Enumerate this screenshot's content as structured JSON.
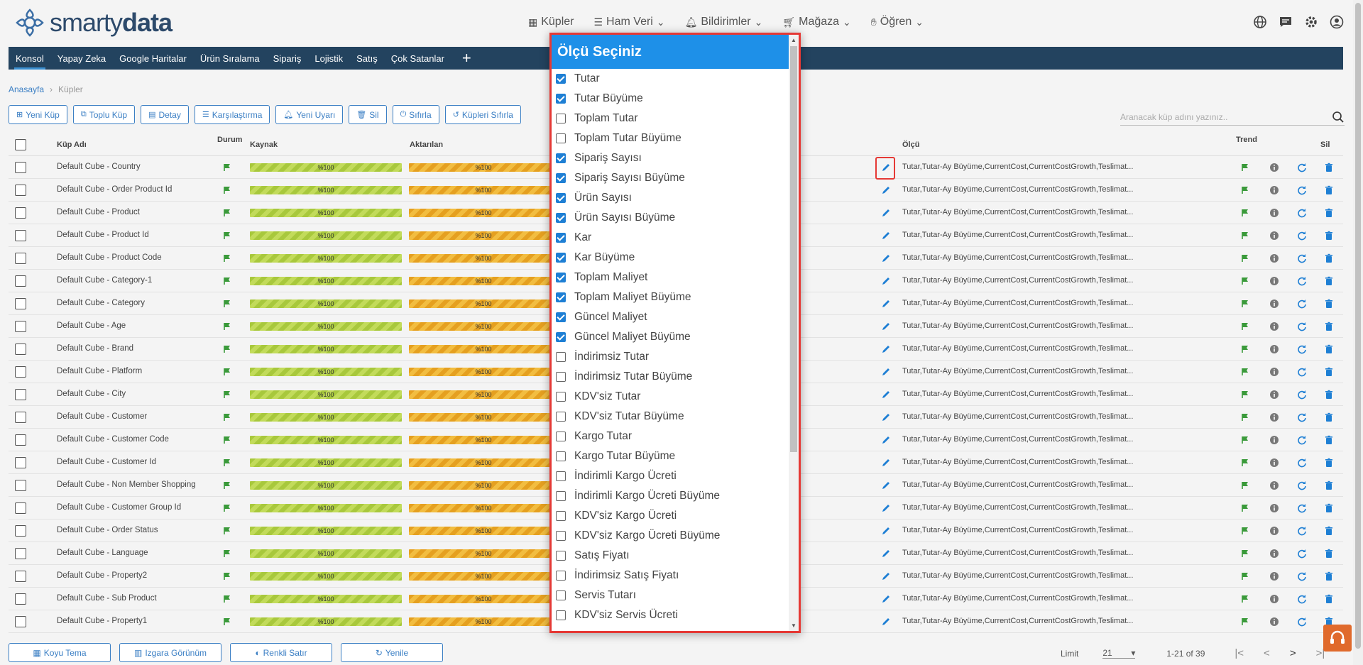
{
  "header": {
    "logo_text_light": "smarty",
    "logo_text_bold": "data",
    "nav": [
      {
        "label": "Küpler",
        "icon": "grid-icon"
      },
      {
        "label": "Ham Veri",
        "icon": "list-icon"
      },
      {
        "label": "Bildirimler",
        "icon": "bell-icon"
      },
      {
        "label": "Mağaza",
        "icon": "cart-icon"
      },
      {
        "label": "Öğren",
        "icon": "hand-icon"
      }
    ]
  },
  "tabs": [
    "Konsol",
    "Yapay Zeka",
    "Google Haritalar",
    "Ürün Sıralama",
    "Sipariş",
    "Lojistik",
    "Satış",
    "Çok Satanlar"
  ],
  "breadcrumb": {
    "home": "Anasayfa",
    "current": "Küpler"
  },
  "toolbar": [
    "Yeni Küp",
    "Toplu Küp",
    "Detay",
    "Karşılaştırma",
    "Yeni Uyarı",
    "Sil",
    "Sıfırla",
    "Küpleri Sıfırla"
  ],
  "search": {
    "placeholder": "Aranacak küp adını yazınız.."
  },
  "table": {
    "headers": {
      "name": "Küp Adı",
      "status": "Durum",
      "source": "Kaynak",
      "transferred": "Aktarılan",
      "measure": "Ölçü",
      "trend": "Trend",
      "delete": "Sil"
    },
    "bar_label": "%100",
    "measure_text": "Tutar,Tutar-Ay Büyüme,CurrentCost,CurrentCostGrowth,Teslimat...",
    "rows": [
      "Default Cube - Country",
      "Default Cube - Order Product Id",
      "Default Cube - Product",
      "Default Cube - Product Id",
      "Default Cube - Product Code",
      "Default Cube - Category-1",
      "Default Cube - Category",
      "Default Cube - Age",
      "Default Cube - Brand",
      "Default Cube - Platform",
      "Default Cube - City",
      "Default Cube - Customer",
      "Default Cube - Customer Code",
      "Default Cube - Customer Id",
      "Default Cube - Non Member Shopping",
      "Default Cube - Customer Group Id",
      "Default Cube - Order Status",
      "Default Cube - Language",
      "Default Cube - Property2",
      "Default Cube - Sub Product",
      "Default Cube - Property1"
    ]
  },
  "footer": {
    "buttons": [
      "Koyu Tema",
      "Izgara Görünüm",
      "Renkli Satır",
      "Yenile"
    ],
    "limit_label": "Limit",
    "limit_value": "21",
    "range": "1-21 of 39"
  },
  "modal": {
    "title": "Ölçü Seçiniz",
    "options": [
      {
        "label": "Tutar",
        "checked": true
      },
      {
        "label": "Tutar Büyüme",
        "checked": true
      },
      {
        "label": "Toplam Tutar",
        "checked": false
      },
      {
        "label": "Toplam Tutar Büyüme",
        "checked": false
      },
      {
        "label": "Sipariş Sayısı",
        "checked": true
      },
      {
        "label": "Sipariş Sayısı Büyüme",
        "checked": true
      },
      {
        "label": "Ürün Sayısı",
        "checked": true
      },
      {
        "label": "Ürün Sayısı Büyüme",
        "checked": true
      },
      {
        "label": "Kar",
        "checked": true
      },
      {
        "label": "Kar Büyüme",
        "checked": true
      },
      {
        "label": "Toplam Maliyet",
        "checked": true
      },
      {
        "label": "Toplam Maliyet Büyüme",
        "checked": true
      },
      {
        "label": "Güncel Maliyet",
        "checked": true
      },
      {
        "label": "Güncel Maliyet Büyüme",
        "checked": true
      },
      {
        "label": "İndirimsiz Tutar",
        "checked": false
      },
      {
        "label": "İndirimsiz Tutar Büyüme",
        "checked": false
      },
      {
        "label": "KDV'siz Tutar",
        "checked": false
      },
      {
        "label": "KDV'siz Tutar Büyüme",
        "checked": false
      },
      {
        "label": "Kargo Tutar",
        "checked": false
      },
      {
        "label": "Kargo Tutar Büyüme",
        "checked": false
      },
      {
        "label": "İndirimli Kargo Ücreti",
        "checked": false
      },
      {
        "label": "İndirimli Kargo Ücreti Büyüme",
        "checked": false
      },
      {
        "label": "KDV'siz Kargo Ücreti",
        "checked": false
      },
      {
        "label": "KDV'siz Kargo Ücreti Büyüme",
        "checked": false
      },
      {
        "label": "Satış Fiyatı",
        "checked": false
      },
      {
        "label": "İndirimsiz Satış Fiyatı",
        "checked": false
      },
      {
        "label": "Servis Tutarı",
        "checked": false
      },
      {
        "label": "KDV'siz Servis Ücreti",
        "checked": false
      }
    ]
  },
  "colors": {
    "accent": "#1e90e8",
    "nav_dark": "#23435f",
    "highlight": "#e53935"
  }
}
